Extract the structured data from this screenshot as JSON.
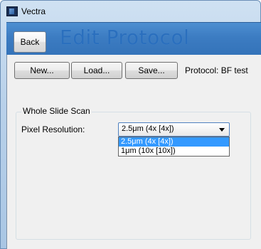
{
  "window": {
    "title": "Vectra",
    "icon": "vectra-app-icon"
  },
  "header": {
    "back_label": "Back",
    "page_title": "Edit Protocol"
  },
  "toolbar": {
    "new_label": "New...",
    "load_label": "Load...",
    "save_label": "Save...",
    "protocol_text": "Protocol: BF test"
  },
  "whole_slide_scan": {
    "group_title": "Whole Slide Scan",
    "pixel_resolution_label": "Pixel Resolution:",
    "selected_value": "2.5μm (4x [4x])",
    "options": [
      {
        "label": "2.5μm (4x [4x])",
        "highlighted": true
      },
      {
        "label": "1μm (10x [10x])",
        "highlighted": false
      }
    ]
  },
  "colors": {
    "header_blue": "#3c7cc2",
    "title_text": "#2a6fbe",
    "selection_highlight": "#3399ff",
    "combo_border": "#4f80bf"
  }
}
